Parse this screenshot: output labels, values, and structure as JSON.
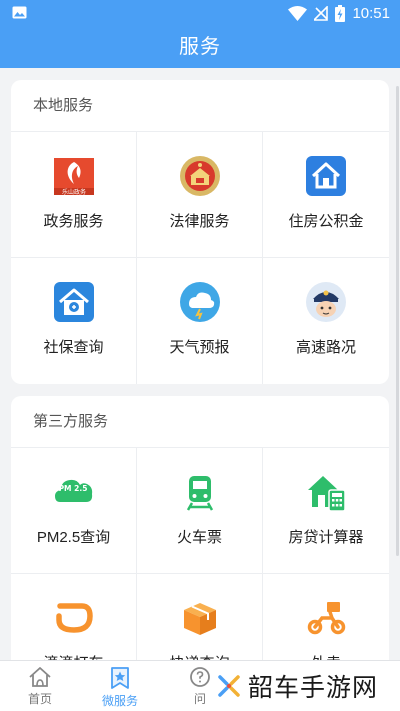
{
  "status_bar": {
    "time": "10:51",
    "icons": [
      "image-icon",
      "wifi-icon",
      "signal-off-icon",
      "battery-charging-icon"
    ]
  },
  "header": {
    "title": "服务"
  },
  "sections": [
    {
      "title": "本地服务",
      "items": [
        {
          "label": "政务服务",
          "icon": "government-affairs-icon",
          "logo_text": "乐山政务"
        },
        {
          "label": "法律服务",
          "icon": "court-emblem-icon"
        },
        {
          "label": "住房公积金",
          "icon": "house-fund-icon"
        },
        {
          "label": "社保查询",
          "icon": "social-security-icon"
        },
        {
          "label": "天气预报",
          "icon": "weather-icon"
        },
        {
          "label": "高速路况",
          "icon": "traffic-police-icon"
        }
      ]
    },
    {
      "title": "第三方服务",
      "items": [
        {
          "label": "PM2.5查询",
          "icon": "pm25-cloud-icon",
          "badge_text": "PM 2.5"
        },
        {
          "label": "火车票",
          "icon": "train-icon"
        },
        {
          "label": "房贷计算器",
          "icon": "mortgage-calculator-icon"
        },
        {
          "label": "滴滴打车",
          "icon": "didi-icon"
        },
        {
          "label": "快递查询",
          "icon": "package-icon"
        },
        {
          "label": "外卖",
          "icon": "scooter-icon"
        }
      ]
    }
  ],
  "tabs": [
    {
      "label": "首页",
      "icon": "home-icon",
      "active": false
    },
    {
      "label": "微服务",
      "icon": "star-bookmark-icon",
      "active": true
    },
    {
      "label": "问",
      "icon": "question-icon",
      "active": false
    }
  ],
  "watermark": {
    "text": "韶车手游网"
  },
  "colors": {
    "primary": "#4a9ff5",
    "green": "#2ebd6b",
    "orange": "#f7932e",
    "background": "#f2f3f5"
  }
}
